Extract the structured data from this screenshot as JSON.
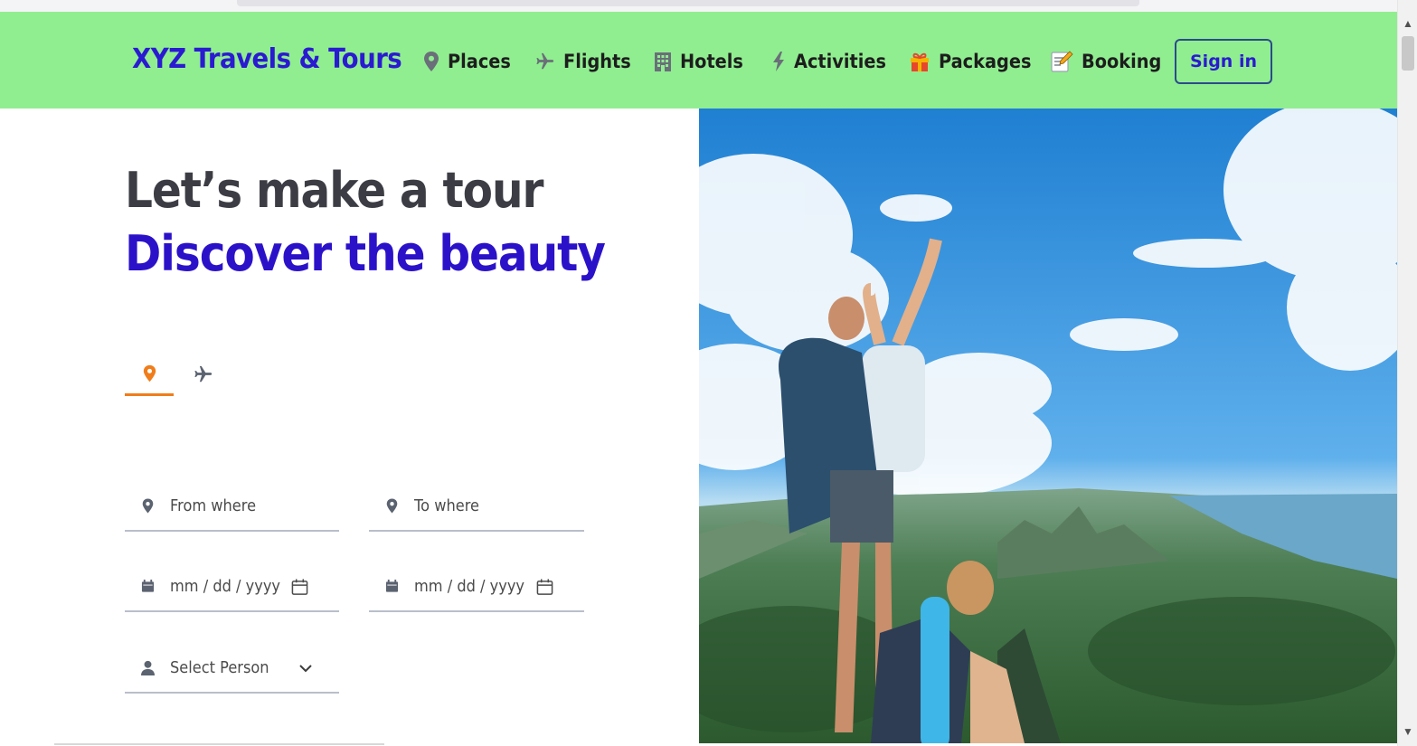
{
  "header": {
    "brand": "XYZ Travels & Tours",
    "nav": [
      {
        "label": "Places",
        "icon": "map-pin-icon"
      },
      {
        "label": "Flights",
        "icon": "airplane-icon"
      },
      {
        "label": "Hotels",
        "icon": "hotel-building-icon"
      },
      {
        "label": "Activities",
        "icon": "lightning-bolt-icon"
      },
      {
        "label": "Packages",
        "icon": "gift-icon"
      },
      {
        "label": "Booking",
        "icon": "memo-icon"
      }
    ],
    "signin": "Sign in"
  },
  "hero": {
    "line1": "Let’s make a tour",
    "line2": "Discover the beauty"
  },
  "search": {
    "tabs": [
      {
        "icon": "map-pin-icon",
        "active": true
      },
      {
        "icon": "airplane-icon",
        "active": false
      }
    ],
    "from_placeholder": "From where",
    "to_placeholder": "To where",
    "date_placeholder_1": "mm / dd / yyyy",
    "date_placeholder_2": "mm / dd / yyyy",
    "person_placeholder": "Select Person"
  },
  "colors": {
    "header_bg": "#90ee90",
    "brand": "#2a1ad1",
    "accent_tab": "#f07d1a",
    "headline_dark": "#3c3d44",
    "headline_blue": "#2b12c9"
  }
}
